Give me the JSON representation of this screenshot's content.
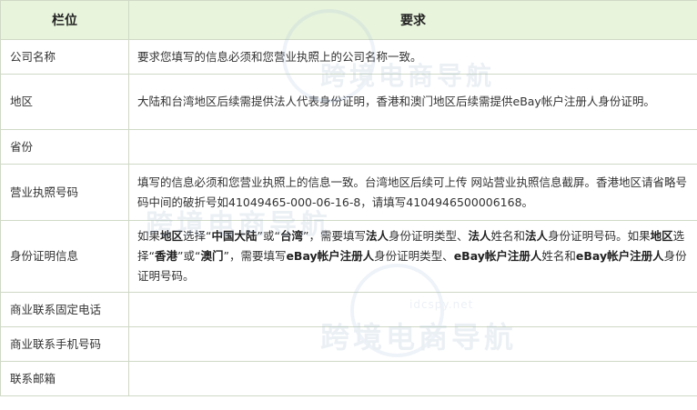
{
  "table": {
    "headers": [
      "栏位",
      "要求"
    ],
    "rows": [
      {
        "label": "公司名称",
        "value_html": "要求您填写的信息必须和您营业执照上的公司名称一致。"
      },
      {
        "label": "地区",
        "value_html": "大陆和台湾地区后续需提供法人代表身份证明，香港和澳门地区后续需提供eBay帐户注册人身份证明。"
      },
      {
        "label": "省份",
        "value_html": ""
      },
      {
        "label": "营业执照号码",
        "value_html": "填写的信息必须和您营业执照上的信息一致。台湾地区后续可上传 网站营业执照信息截屏。香港地区请省略号码中间的破折号如41049465-000-06-16-8，请填写4104946500006168。"
      },
      {
        "label": "身份证明信息",
        "value_html": "如果<b>地区</b>选择“<b>中国大陆</b>”或“<b>台湾</b>”，需要填写<b>法人</b>身份证明类型、<b>法人</b>姓名和<b>法人</b>身份证明号码。如果<b>地区</b>选择“<b>香港</b>”或“<b>澳门</b>”，需要填写<b>eBay帐户注册人</b>身份证明类型、<b>eBay帐户注册人</b>姓名和<b>eBay帐户注册人</b>身份证明号码。"
      },
      {
        "label": "商业联系固定电话",
        "value_html": ""
      },
      {
        "label": "商业联系手机号码",
        "value_html": ""
      },
      {
        "label": "联系邮箱",
        "value_html": ""
      }
    ]
  },
  "watermark": {
    "text": "跨境电商导航",
    "domain": "idcspy.net"
  }
}
